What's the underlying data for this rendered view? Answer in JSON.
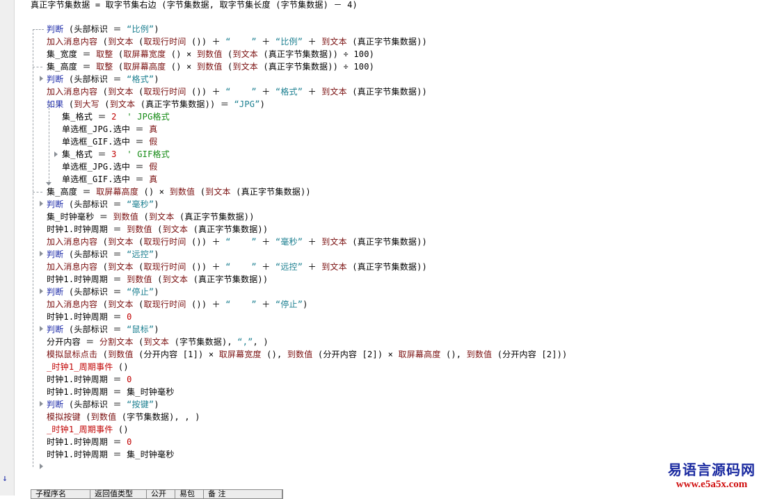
{
  "editor": {
    "header_line": "真正字节集数据 = 取字节集右边 (字节集数据, 取字节集长度 (字节集数据) － 4)",
    "lines": [
      [
        [
          "kw",
          "判断"
        ],
        [
          "",
          " (头部标识 ＝ "
        ],
        [
          "str",
          "“比例”"
        ],
        [
          "",
          ")"
        ]
      ],
      [
        [
          "fn",
          "加入消息内容"
        ],
        [
          "",
          " ("
        ],
        [
          "fn",
          "到文本"
        ],
        [
          "",
          " ("
        ],
        [
          "fn",
          "取现行时间"
        ],
        [
          "",
          " ()) ＋ "
        ],
        [
          "str",
          "“    ”"
        ],
        [
          "",
          " ＋ "
        ],
        [
          "str",
          "“比例”"
        ],
        [
          "",
          " ＋ "
        ],
        [
          "fn",
          "到文本"
        ],
        [
          "",
          " (真正字节集数据))"
        ]
      ],
      [
        [
          "",
          "集_宽度 ＝ "
        ],
        [
          "fn",
          "取整"
        ],
        [
          "",
          " ("
        ],
        [
          "fn",
          "取屏幕宽度"
        ],
        [
          "",
          " () × "
        ],
        [
          "fn",
          "到数值"
        ],
        [
          "",
          " ("
        ],
        [
          "fn",
          "到文本"
        ],
        [
          "",
          " (真正字节集数据)) ÷ 100)"
        ]
      ],
      [
        [
          "",
          "集_高度 ＝ "
        ],
        [
          "fn",
          "取整"
        ],
        [
          "",
          " ("
        ],
        [
          "fn",
          "取屏幕高度"
        ],
        [
          "",
          " () × "
        ],
        [
          "fn",
          "到数值"
        ],
        [
          "",
          " ("
        ],
        [
          "fn",
          "到文本"
        ],
        [
          "",
          " (真正字节集数据)) ÷ 100)"
        ]
      ],
      [
        [
          "kw",
          "判断"
        ],
        [
          "",
          " (头部标识 ＝ "
        ],
        [
          "str",
          "“格式”"
        ],
        [
          "",
          ")"
        ]
      ],
      [
        [
          "fn",
          "加入消息内容"
        ],
        [
          "",
          " ("
        ],
        [
          "fn",
          "到文本"
        ],
        [
          "",
          " ("
        ],
        [
          "fn",
          "取现行时间"
        ],
        [
          "",
          " ()) ＋ "
        ],
        [
          "str",
          "“    ”"
        ],
        [
          "",
          " ＋ "
        ],
        [
          "str",
          "“格式”"
        ],
        [
          "",
          " ＋ "
        ],
        [
          "fn",
          "到文本"
        ],
        [
          "",
          " (真正字节集数据))"
        ]
      ],
      [
        [
          "kw",
          "如果"
        ],
        [
          "",
          " ("
        ],
        [
          "fn",
          "到大写"
        ],
        [
          "",
          " ("
        ],
        [
          "fn",
          "到文本"
        ],
        [
          "",
          " (真正字节集数据)) ＝ "
        ],
        [
          "str",
          "“JPG”"
        ],
        [
          "",
          ")"
        ]
      ],
      [
        [
          "",
          "集_格式 ＝ "
        ],
        [
          "num",
          "2"
        ],
        [
          "",
          "  "
        ],
        [
          "cmt",
          "' JPG格式"
        ]
      ],
      [
        [
          "",
          "单选框_JPG.选中 ＝ "
        ],
        [
          "fn",
          "真"
        ]
      ],
      [
        [
          "",
          "单选框_GIF.选中 ＝ "
        ],
        [
          "fn",
          "假"
        ]
      ],
      [
        [
          "",
          "集_格式 ＝ "
        ],
        [
          "num",
          "3"
        ],
        [
          "",
          "  "
        ],
        [
          "cmt",
          "' GIF格式"
        ]
      ],
      [
        [
          "",
          "单选框_JPG.选中 ＝ "
        ],
        [
          "fn",
          "假"
        ]
      ],
      [
        [
          "",
          "单选框_GIF.选中 ＝ "
        ],
        [
          "fn",
          "真"
        ]
      ],
      [
        [
          "",
          "集_高度 ＝ "
        ],
        [
          "fn",
          "取屏幕高度"
        ],
        [
          "",
          " () × "
        ],
        [
          "fn",
          "到数值"
        ],
        [
          "",
          " ("
        ],
        [
          "fn",
          "到文本"
        ],
        [
          "",
          " (真正字节集数据))"
        ]
      ],
      [
        [
          "kw",
          "判断"
        ],
        [
          "",
          " (头部标识 ＝ "
        ],
        [
          "str",
          "“毫秒”"
        ],
        [
          "",
          ")"
        ]
      ],
      [
        [
          "",
          "集_时钟毫秒 ＝ "
        ],
        [
          "fn",
          "到数值"
        ],
        [
          "",
          " ("
        ],
        [
          "fn",
          "到文本"
        ],
        [
          "",
          " (真正字节集数据))"
        ]
      ],
      [
        [
          "",
          "时钟1.时钟周期 ＝ "
        ],
        [
          "fn",
          "到数值"
        ],
        [
          "",
          " ("
        ],
        [
          "fn",
          "到文本"
        ],
        [
          "",
          " (真正字节集数据))"
        ]
      ],
      [
        [
          "fn",
          "加入消息内容"
        ],
        [
          "",
          " ("
        ],
        [
          "fn",
          "到文本"
        ],
        [
          "",
          " ("
        ],
        [
          "fn",
          "取现行时间"
        ],
        [
          "",
          " ()) ＋ "
        ],
        [
          "str",
          "“    ”"
        ],
        [
          "",
          " ＋ "
        ],
        [
          "str",
          "“毫秒”"
        ],
        [
          "",
          " ＋ "
        ],
        [
          "fn",
          "到文本"
        ],
        [
          "",
          " (真正字节集数据))"
        ]
      ],
      [
        [
          "kw",
          "判断"
        ],
        [
          "",
          " (头部标识 ＝ "
        ],
        [
          "str",
          "“远控”"
        ],
        [
          "",
          ")"
        ]
      ],
      [
        [
          "fn",
          "加入消息内容"
        ],
        [
          "",
          " ("
        ],
        [
          "fn",
          "到文本"
        ],
        [
          "",
          " ("
        ],
        [
          "fn",
          "取现行时间"
        ],
        [
          "",
          " ()) ＋ "
        ],
        [
          "str",
          "“    ”"
        ],
        [
          "",
          " ＋ "
        ],
        [
          "str",
          "“远控”"
        ],
        [
          "",
          " ＋ "
        ],
        [
          "fn",
          "到文本"
        ],
        [
          "",
          " (真正字节集数据))"
        ]
      ],
      [
        [
          "",
          "时钟1.时钟周期 ＝ "
        ],
        [
          "fn",
          "到数值"
        ],
        [
          "",
          " ("
        ],
        [
          "fn",
          "到文本"
        ],
        [
          "",
          " (真正字节集数据))"
        ]
      ],
      [
        [
          "kw",
          "判断"
        ],
        [
          "",
          " (头部标识 ＝ "
        ],
        [
          "str",
          "“停止”"
        ],
        [
          "",
          ")"
        ]
      ],
      [
        [
          "fn",
          "加入消息内容"
        ],
        [
          "",
          " ("
        ],
        [
          "fn",
          "到文本"
        ],
        [
          "",
          " ("
        ],
        [
          "fn",
          "取现行时间"
        ],
        [
          "",
          " ()) ＋ "
        ],
        [
          "str",
          "“    ”"
        ],
        [
          "",
          " ＋ "
        ],
        [
          "str",
          "“停止”"
        ],
        [
          "",
          ")"
        ]
      ],
      [
        [
          "",
          "时钟1.时钟周期 ＝ "
        ],
        [
          "num",
          "0"
        ]
      ],
      [
        [
          "kw",
          "判断"
        ],
        [
          "",
          " (头部标识 ＝ "
        ],
        [
          "str",
          "“鼠标”"
        ],
        [
          "",
          ")"
        ]
      ],
      [
        [
          "",
          "分开内容 ＝ "
        ],
        [
          "fn",
          "分割文本"
        ],
        [
          "",
          " ("
        ],
        [
          "fn",
          "到文本"
        ],
        [
          "",
          " (字节集数据), "
        ],
        [
          "str",
          "“,”"
        ],
        [
          "",
          ", )"
        ]
      ],
      [
        [
          "fn",
          "模拟鼠标点击"
        ],
        [
          "",
          " ("
        ],
        [
          "fn",
          "到数值"
        ],
        [
          "",
          " (分开内容 [1]) × "
        ],
        [
          "fn",
          "取屏幕宽度"
        ],
        [
          "",
          " (), "
        ],
        [
          "fn",
          "到数值"
        ],
        [
          "",
          " (分开内容 [2]) × "
        ],
        [
          "fn",
          "取屏幕高度"
        ],
        [
          "",
          " (), "
        ],
        [
          "fn",
          "到数值"
        ],
        [
          "",
          " (分开内容 [2]))"
        ]
      ],
      [
        [
          "ex",
          "_时钟1_周期事件"
        ],
        [
          "",
          " ()"
        ]
      ],
      [
        [
          "",
          "时钟1.时钟周期 ＝ "
        ],
        [
          "num",
          "0"
        ]
      ],
      [
        [
          "",
          "时钟1.时钟周期 ＝ 集_时钟毫秒"
        ]
      ],
      [
        [
          "kw",
          "判断"
        ],
        [
          "",
          " (头部标识 ＝ "
        ],
        [
          "str",
          "“按键”"
        ],
        [
          "",
          ")"
        ]
      ],
      [
        [
          "fn",
          "模拟按键"
        ],
        [
          "",
          " ("
        ],
        [
          "fn",
          "到数值"
        ],
        [
          "",
          " (字节集数据), , )"
        ]
      ],
      [
        [
          "ex",
          "_时钟1_周期事件"
        ],
        [
          "",
          " ()"
        ]
      ],
      [
        [
          "",
          "时钟1.时钟周期 ＝ "
        ],
        [
          "num",
          "0"
        ]
      ],
      [
        [
          "",
          "时钟1.时钟周期 ＝ 集_时钟毫秒"
        ]
      ]
    ]
  },
  "table_header": [
    "子程序名",
    "返回值类型",
    "公开",
    "易包",
    "备 注"
  ],
  "watermark": {
    "title": "易语言源码网",
    "url": "www.e5a5x.com"
  }
}
